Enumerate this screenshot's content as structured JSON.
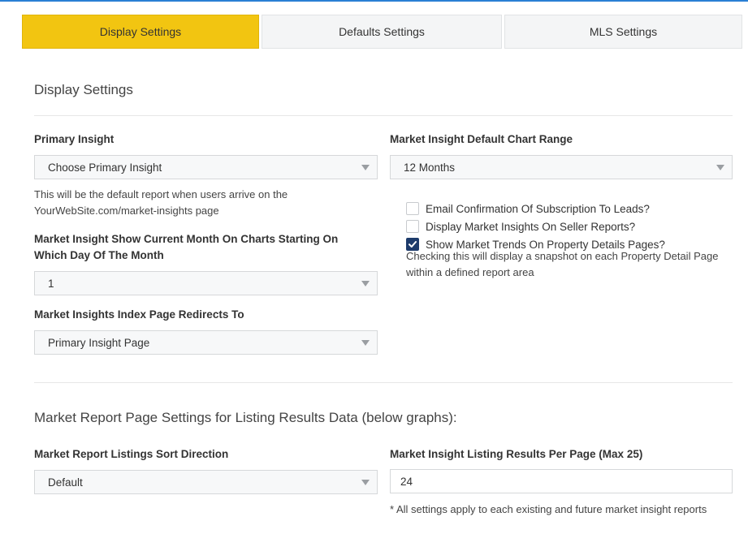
{
  "tabs": [
    {
      "label": "Display Settings",
      "active": true
    },
    {
      "label": "Defaults Settings",
      "active": false
    },
    {
      "label": "MLS Settings",
      "active": false
    }
  ],
  "colors": {
    "active_tab": "#f2c511",
    "top_accent": "#2a7fd4",
    "checkbox_checked": "#1d3b6b"
  },
  "display_section": {
    "title": "Display Settings",
    "primary_insight": {
      "label": "Primary Insight",
      "value": "Choose Primary Insight",
      "help": "This will be the default report when users arrive on the YourWebSite.com/market-insights page"
    },
    "chart_range": {
      "label": "Market Insight Default Chart Range",
      "value": "12 Months"
    },
    "current_month": {
      "label": "Market Insight Show Current Month On Charts Starting On Which Day Of The Month",
      "value": "1"
    },
    "index_redirect": {
      "label": "Market Insights Index Page Redirects To",
      "value": "Primary Insight Page"
    },
    "checkboxes": [
      {
        "label": "Email Confirmation Of Subscription To Leads?",
        "checked": false
      },
      {
        "label": "Display Market Insights On Seller Reports?",
        "checked": false
      },
      {
        "label": "Show Market Trends On Property Details Pages?",
        "checked": true
      }
    ],
    "trends_help": "Checking this will display a snapshot on each Property Detail Page within a defined report area"
  },
  "report_section": {
    "title": "Market Report Page Settings for Listing Results Data (below graphs):",
    "sort_direction": {
      "label": "Market Report Listings Sort Direction",
      "value": "Default"
    },
    "results_per_page": {
      "label": "Market Insight Listing Results Per Page (Max 25)",
      "value": "24"
    },
    "note": "* All settings apply to each existing and future market insight reports"
  }
}
